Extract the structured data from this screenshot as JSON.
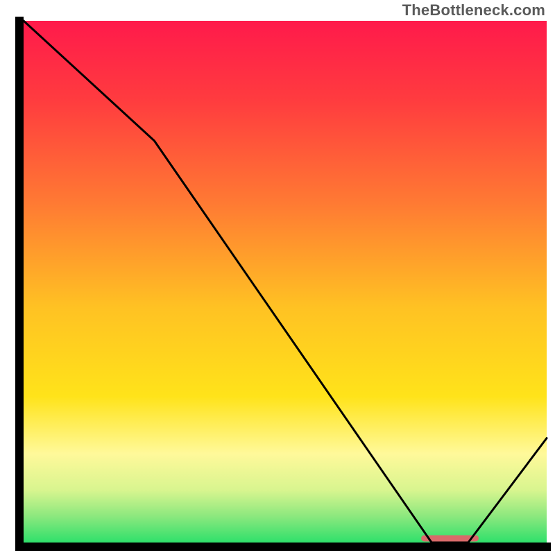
{
  "watermark": "TheBottleneck.com",
  "chart_data": {
    "type": "line",
    "title": "",
    "xlabel": "",
    "ylabel": "",
    "xlim": [
      0,
      100
    ],
    "ylim": [
      0,
      100
    ],
    "series": [
      {
        "name": "bottleneck-curve",
        "x": [
          0,
          25,
          78,
          85,
          100
        ],
        "y": [
          100,
          77,
          0,
          0,
          20
        ]
      }
    ],
    "optimal_marker": {
      "x_start": 76,
      "x_end": 87,
      "y": 0.8
    },
    "gradient_stops": [
      {
        "offset": 0.0,
        "color": "#ff1a4b"
      },
      {
        "offset": 0.15,
        "color": "#ff3b3f"
      },
      {
        "offset": 0.35,
        "color": "#ff7a33"
      },
      {
        "offset": 0.55,
        "color": "#ffc223"
      },
      {
        "offset": 0.72,
        "color": "#ffe31a"
      },
      {
        "offset": 0.83,
        "color": "#fff99a"
      },
      {
        "offset": 0.9,
        "color": "#d8f58f"
      },
      {
        "offset": 0.95,
        "color": "#8be87e"
      },
      {
        "offset": 1.0,
        "color": "#2fe06b"
      }
    ],
    "style": {
      "frame_line_width": 12,
      "curve_line_width": 3,
      "marker_color": "#d96a6a",
      "marker_height": 9
    }
  }
}
